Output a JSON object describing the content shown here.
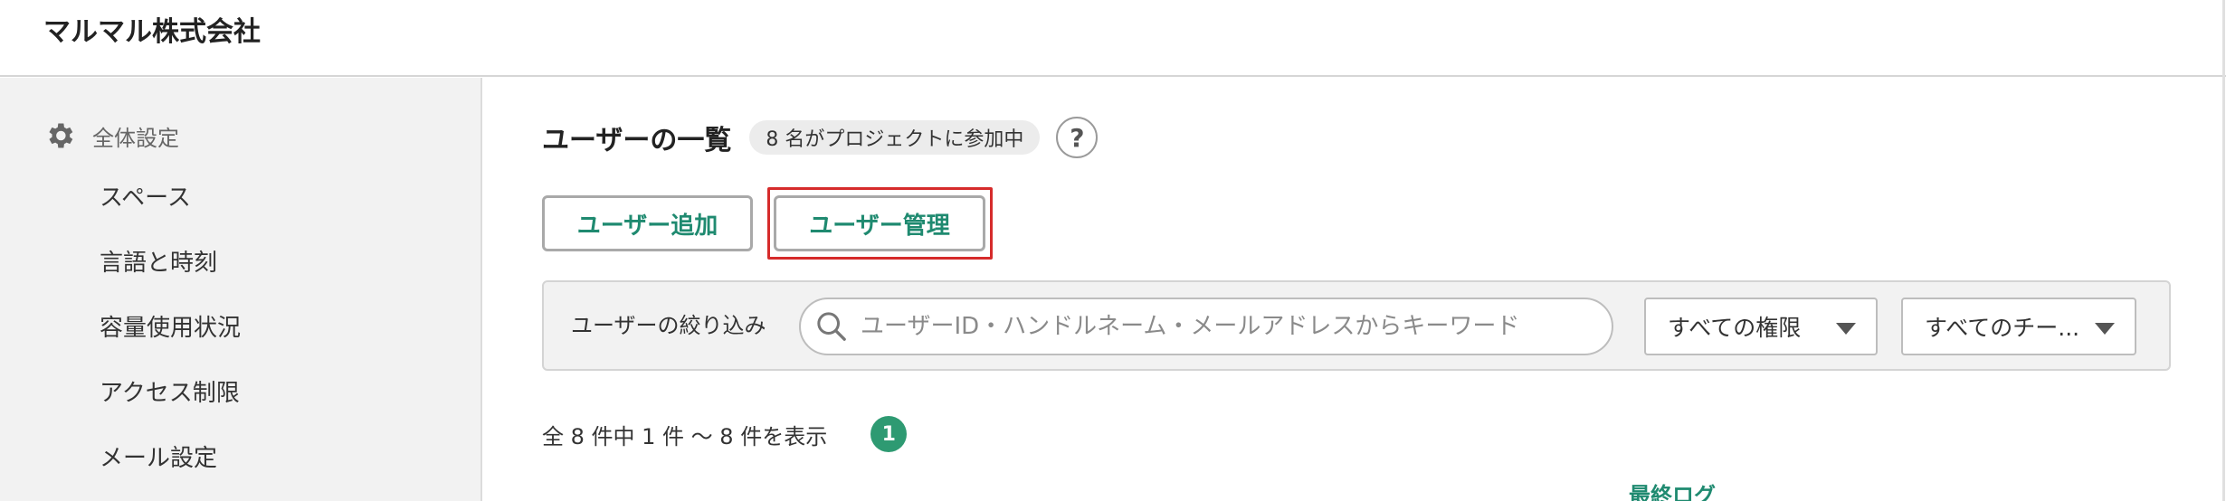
{
  "header": {
    "company": "マルマル株式会社"
  },
  "sidebar": {
    "section_title": "全体設定",
    "items": [
      {
        "label": "スペース"
      },
      {
        "label": "言語と時刻"
      },
      {
        "label": "容量使用状況"
      },
      {
        "label": "アクセス制限"
      },
      {
        "label": "メール設定"
      }
    ]
  },
  "main": {
    "title": "ユーザーの一覧",
    "member_badge": "8 名がプロジェクトに参加中",
    "help_label": "?",
    "buttons": {
      "add_user": "ユーザー追加",
      "manage_users": "ユーザー管理"
    },
    "filter": {
      "label": "ユーザーの絞り込み",
      "search_placeholder": "ユーザーID・ハンドルネーム・メールアドレスからキーワード",
      "role_select": "すべての権限",
      "team_select": "すべてのチー..."
    },
    "result_summary": "全 8 件中 1 件 〜 8 件を表示",
    "pagination": {
      "current_page": "1"
    },
    "table": {
      "column_last_login": "最終ログ"
    }
  },
  "colors": {
    "accent": "#1f8a70",
    "page_dot": "#2e9a72",
    "highlight": "#d62b2b"
  }
}
